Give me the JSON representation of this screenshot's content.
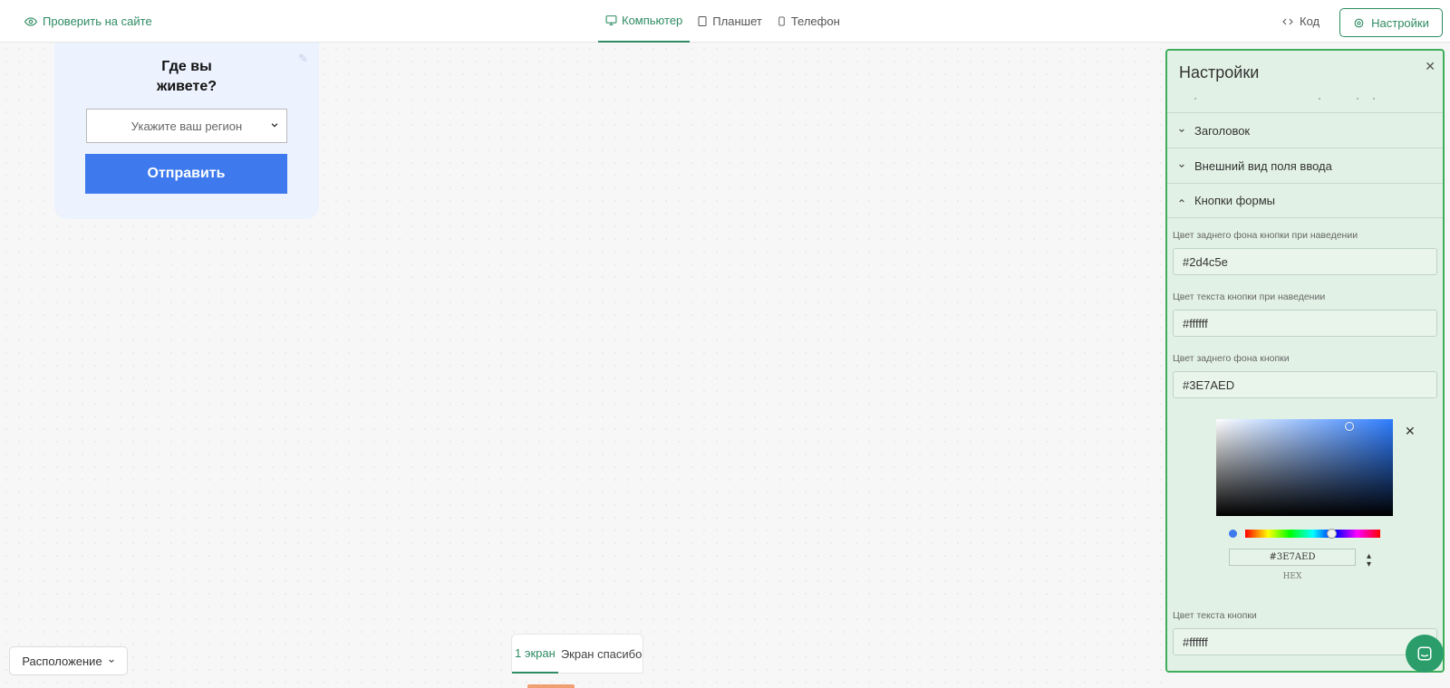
{
  "topbar": {
    "check_site": "Проверить на сайте",
    "tabs": [
      {
        "label": "Компьютер",
        "active": true,
        "icon": "desktop-icon"
      },
      {
        "label": "Планшет",
        "active": false,
        "icon": "tablet-icon"
      },
      {
        "label": "Телефон",
        "active": false,
        "icon": "phone-icon"
      }
    ],
    "code": "Код",
    "settings": "Настройки"
  },
  "widget": {
    "title_line1": "Где вы",
    "title_line2": "живете?",
    "select_placeholder": "Укажите ваш регион",
    "submit": "Отправить"
  },
  "bottom": {
    "layout": "Расположение",
    "screens": [
      {
        "label": "1 экран",
        "active": true
      },
      {
        "label": "Экран спасибо",
        "active": false
      }
    ]
  },
  "panel": {
    "title": "Настройки",
    "sections": [
      {
        "label": "Заголовок",
        "expanded": false
      },
      {
        "label": "Внешний вид поля ввода",
        "expanded": false
      },
      {
        "label": "Кнопки формы",
        "expanded": true
      }
    ],
    "fields": [
      {
        "label": "Цвет заднего фона кнопки при наведении",
        "value": "#2d4c5e"
      },
      {
        "label": "Цвет текста кнопки при наведении",
        "value": "#ffffff"
      },
      {
        "label": "Цвет заднего фона кнопки",
        "value": "#3E7AED"
      },
      {
        "label": "Цвет текста кнопки",
        "value": "#ffffff"
      }
    ],
    "picker": {
      "hex_value": "#3E7AED",
      "mode_label": "HEX"
    }
  },
  "colors": {
    "accent": "#2e8b63",
    "button": "#3e7aed",
    "panel_border": "#3fae5c",
    "panel_bg": "#e2f1e5"
  }
}
